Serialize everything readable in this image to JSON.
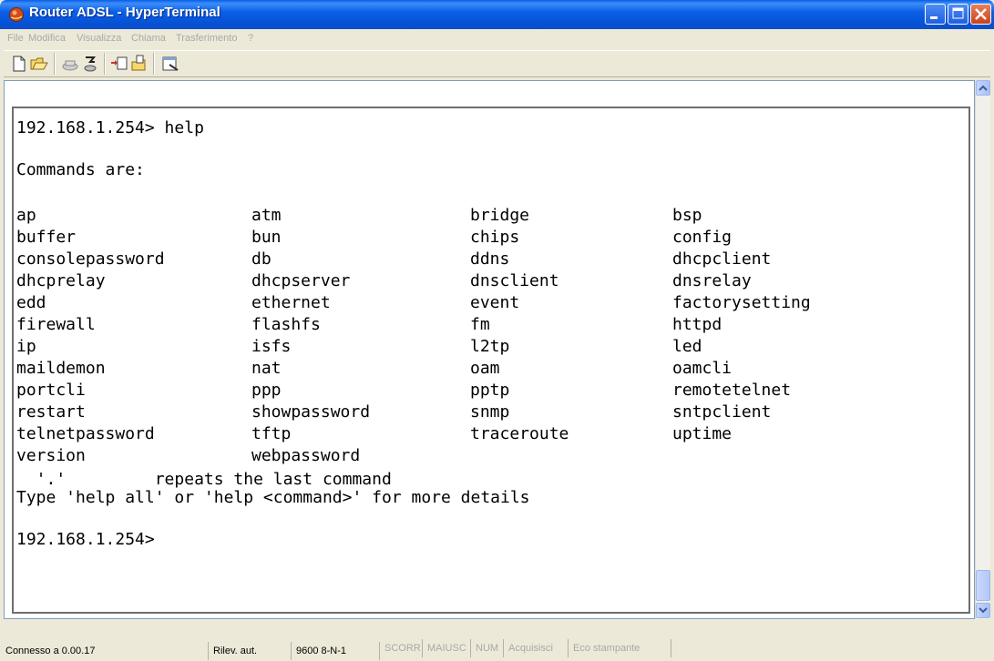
{
  "window": {
    "title": "Router ADSL - HyperTerminal",
    "icon": "phone-globe-icon"
  },
  "menu": {
    "items": [
      "File",
      "Modifica",
      "Visualizza",
      "Chiama",
      "Trasferimento",
      "?"
    ]
  },
  "toolbar": {
    "icons": [
      "new-icon",
      "open-icon",
      "connect-icon",
      "disconnect-icon",
      "send-icon",
      "receive-icon",
      "properties-icon"
    ]
  },
  "terminal": {
    "prompt_help": "192.168.1.254> help",
    "commands_header": "Commands are:",
    "commands": [
      [
        "ap",
        "atm",
        "bridge",
        "bsp"
      ],
      [
        "buffer",
        "bun",
        "chips",
        "config"
      ],
      [
        "consolepassword",
        "db",
        "ddns",
        "dhcpclient"
      ],
      [
        "dhcprelay",
        "dhcpserver",
        "dnsclient",
        "dnsrelay"
      ],
      [
        "edd",
        "ethernet",
        "event",
        "factorysetting"
      ],
      [
        "firewall",
        "flashfs",
        "fm",
        "httpd"
      ],
      [
        "ip",
        "isfs",
        "l2tp",
        "led"
      ],
      [
        "maildemon",
        "nat",
        "oam",
        "oamcli"
      ],
      [
        "portcli",
        "ppp",
        "pptp",
        "remotetelnet"
      ],
      [
        "restart",
        "showpassword",
        "snmp",
        "sntpclient"
      ],
      [
        "telnetpassword",
        "tftp",
        "traceroute",
        "uptime"
      ],
      [
        "version",
        "webpassword"
      ]
    ],
    "repeat_line": "  '.'         repeats the last command",
    "help_hint": "Type 'help all' or 'help <command>' for more details",
    "prompt_final": "192.168.1.254>"
  },
  "statusbar": {
    "connection": "Connesso a 0.00.17",
    "detect": "Rilev. aut.",
    "settings": "9600 8-N-1",
    "scroll": "SCORR",
    "caps": "MAIUSC",
    "num": "NUM",
    "capture": "Acquisisci",
    "print_echo": "Eco stampante"
  },
  "colors": {
    "titlebar": "#0a5ee8",
    "window_bg": "#ece9d8",
    "terminal_bg": "#ffffff",
    "disabled_text": "#a8a8a8"
  }
}
